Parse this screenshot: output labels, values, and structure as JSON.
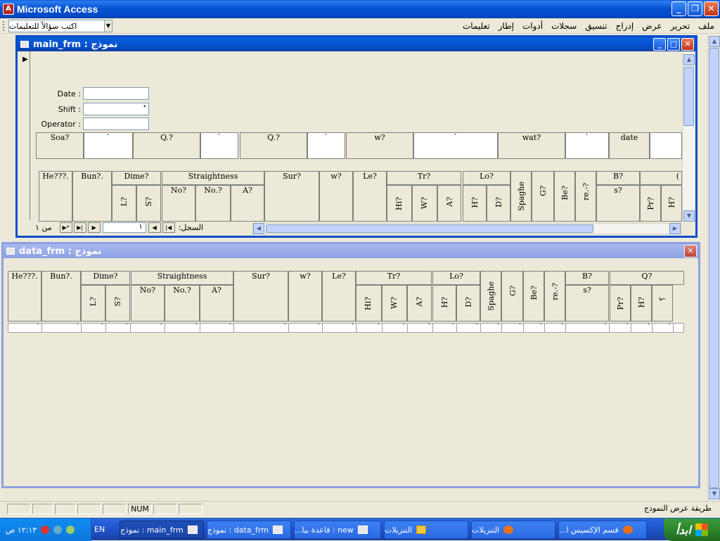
{
  "app": {
    "title": "Microsoft Access"
  },
  "menu": {
    "help_placeholder": "اكتب سؤالاً للتعليمات",
    "items": [
      "ملف",
      "تحرير",
      "عرض",
      "إدراج",
      "تنسيق",
      "سجلات",
      "أدوات",
      "إطار",
      "تعليمات"
    ]
  },
  "main_form": {
    "title": "main_frm : نموذج",
    "date_label": "Date :",
    "shift_label": "Shift :",
    "operator_label": "Operator :",
    "shift_dot": "•",
    "top_row": [
      "Soa?",
      "`",
      "Q.?",
      "`",
      "Q.?",
      "`",
      "w?",
      "`",
      "wat?",
      "`",
      "date"
    ],
    "grid_groups": [
      "He???.",
      "Bun?.",
      "Dime?",
      "Straightness",
      "Sur?",
      "w?",
      "Le?",
      "Tr?",
      "Lo?",
      "Spaghe",
      "G?",
      "Be?",
      "re.-?",
      "B?",
      "("
    ],
    "grid_sub": [
      "L?",
      "S?",
      "No?",
      "No.?",
      "A?",
      "Hi?",
      "W?",
      "A?",
      "H?",
      "D?",
      "s?",
      "Pr?",
      "H?"
    ],
    "record_label": "السجل:",
    "record_num": "١",
    "record_of": "من  ١"
  },
  "data_form": {
    "title": "data_frm : نموذج",
    "groups": [
      "He???.",
      "Bun?.",
      "Dime?",
      "Straightness",
      "Sur?",
      "w?",
      "Le?",
      "Tr?",
      "Lo?",
      "Spaghe",
      "G?",
      "Be?",
      "re.-?",
      "B?",
      "Q?"
    ],
    "subs": [
      "L?",
      "S?",
      "No?",
      "No.?",
      "A?",
      "Hi?",
      "W?",
      "A?",
      "H?",
      "D?",
      "s?",
      "Pr?",
      "H?",
      "؟"
    ],
    "row_mark": "`"
  },
  "status": {
    "num": "NUM",
    "text": "طريقة عرض النموذج"
  },
  "taskbar": {
    "start": "ابدأ",
    "buttons": [
      "قسم الإكسيس ا...",
      "التنزيلات",
      "التنزيلات",
      "new : قاعدة بيا...",
      "data_frm : نموذج",
      "main_frm : نموذج"
    ],
    "lang": "EN",
    "clock": "١٢:١٣ ص"
  },
  "colors": {
    "xp_blue": "#0553d2",
    "form_bg": "#ece9d8",
    "start_green": "#2f8a2f"
  }
}
